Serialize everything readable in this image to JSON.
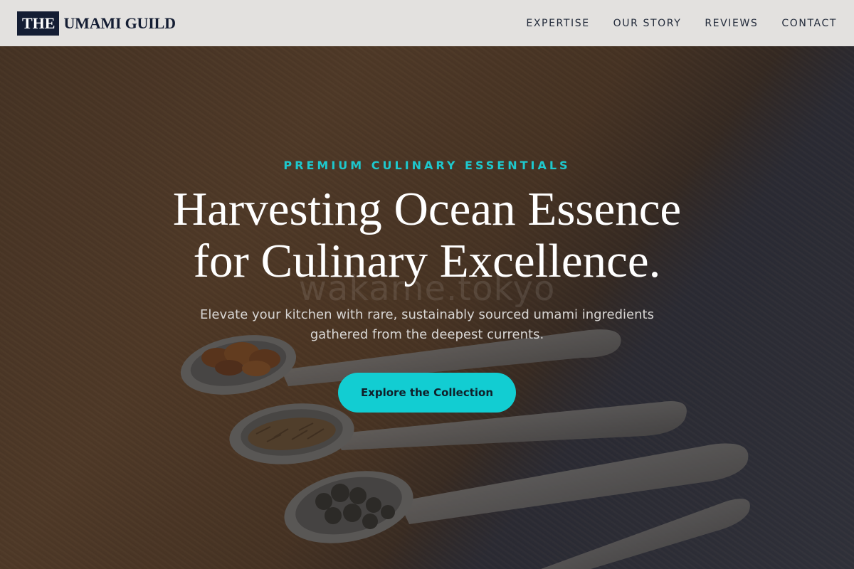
{
  "header": {
    "logo_badge": "THE",
    "logo_text": "UMAMI GUILD",
    "nav": [
      {
        "label": "EXPERTISE"
      },
      {
        "label": "OUR STORY"
      },
      {
        "label": "REVIEWS"
      },
      {
        "label": "CONTACT"
      }
    ]
  },
  "hero": {
    "eyebrow": "PREMIUM CULINARY ESSENTIALS",
    "headline_line1": "Harvesting Ocean Essence",
    "headline_line2": "for Culinary Excellence.",
    "watermark": "wakame.tokyo",
    "subtitle_line1": "Elevate your kitchen with rare, sustainably sourced umami ingredients",
    "subtitle_line2": "gathered from the deepest currents.",
    "cta_label": "Explore the Collection"
  },
  "colors": {
    "accent": "#12cdd2",
    "eyebrow": "#1ec8cd",
    "brand_navy": "#141d33",
    "header_bg": "#e3e1df"
  },
  "icons": [
    "spoon-image"
  ]
}
